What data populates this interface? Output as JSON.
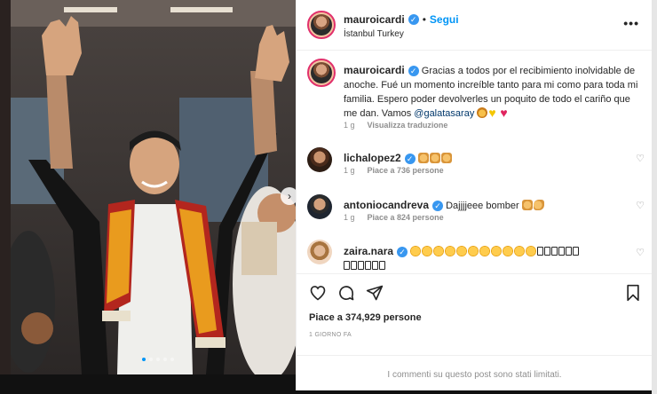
{
  "post": {
    "username": "mauroicardi",
    "separator": "•",
    "follow_label": "Segui",
    "location": "İstanbul Turkey",
    "more_icon": "more-horizontal-icon",
    "image_count": 5,
    "active_image": 0
  },
  "caption": {
    "username": "mauroicardi",
    "text": "Gracias a todos por el recibimiento inolvidable de anoche. Fué un momento increíble tanto para mi como para toda mi familia. Espero poder devolverles un poquito de todo el cariño que me dan. Vamos ",
    "mention": "@galatasaray",
    "emojis": [
      "lion-emoji",
      "yellow-heart-emoji",
      "red-heart-emoji"
    ],
    "time": "1 g",
    "translate_label": "Visualizza traduzione"
  },
  "comments": [
    {
      "username": "lichalopez2",
      "verified": true,
      "text": "",
      "emoji_summary": "three raising-hands emojis",
      "time": "1 g",
      "likes": "Piace a 736 persone"
    },
    {
      "username": "antoniocandreva",
      "verified": true,
      "text": "Dajjjjeee bomber",
      "emoji_summary": "raising-hands and flexed-biceps emojis",
      "time": "1 g",
      "likes": "Piace a 824 persone"
    },
    {
      "username": "zaira.nara",
      "verified": true,
      "text": "",
      "emoji_summary": "eleven astonished-face emojis followed by unrendered glyph boxes",
      "time": "",
      "likes": ""
    }
  ],
  "actions": {
    "like_icon": "heart-outline-icon",
    "comment_icon": "comment-icon",
    "share_icon": "paper-plane-icon",
    "save_icon": "bookmark-icon"
  },
  "likes_total": "Piace a 374,929 persone",
  "date": "1 GIORNO FA",
  "comments_limited": "I commenti su questo post sono stati limitati.",
  "colors": {
    "accent": "#0095f6",
    "verified": "#3897f0",
    "text": "#262626",
    "muted": "#8e8e8e",
    "scarf_red": "#b3261e",
    "scarf_yellow": "#f2b01e"
  }
}
